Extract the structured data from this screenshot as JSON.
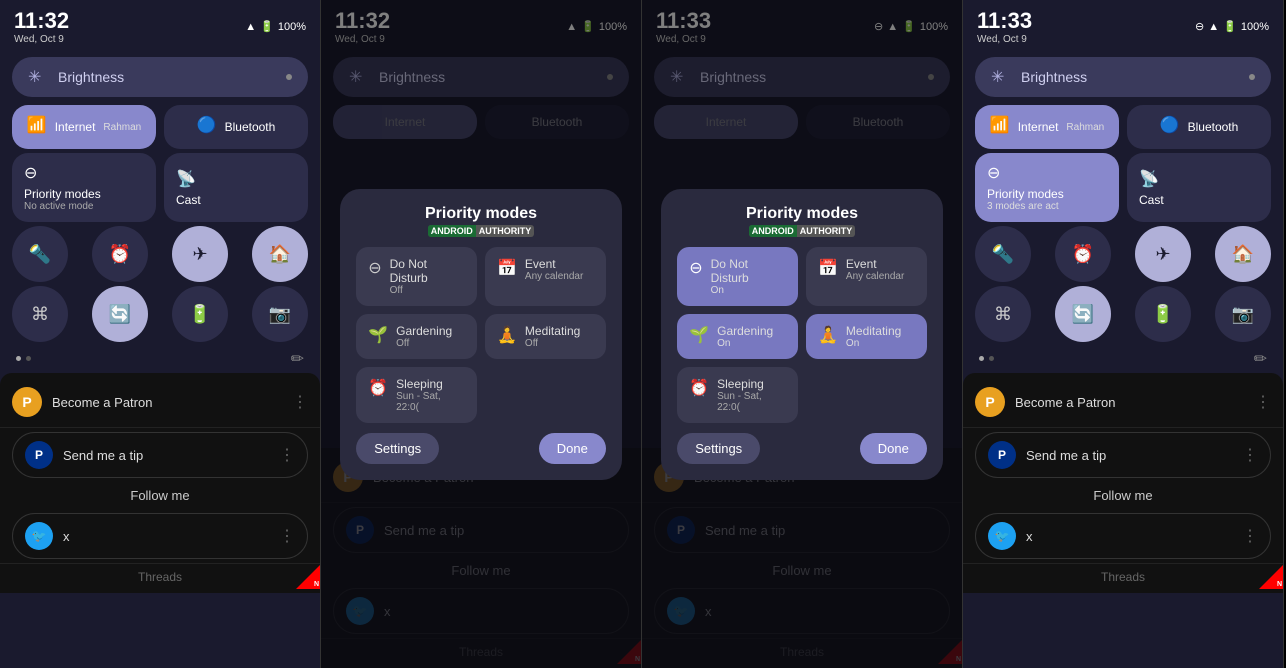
{
  "panels": [
    {
      "id": "panel1",
      "time": "11:32",
      "date": "Wed, Oct 9",
      "battery": "100%",
      "brightness": "Brightness",
      "internet_label": "Internet",
      "internet_sub": "Rahman",
      "bluetooth_label": "Bluetooth",
      "priority_label": "Priority modes",
      "priority_sub": "No active mode",
      "cast_label": "Cast",
      "has_overlay": false,
      "overlay_type": null
    },
    {
      "id": "panel2",
      "time": "11:32",
      "date": "Wed, Oct 9",
      "battery": "100%",
      "brightness": "Brightness",
      "internet_label": "Internet",
      "internet_sub": "Rahman",
      "bluetooth_label": "Bluetooth",
      "has_overlay": true,
      "overlay_type": "modes_off"
    },
    {
      "id": "panel3",
      "time": "11:33",
      "date": "Wed, Oct 9",
      "battery": "100%",
      "brightness": "Brightness",
      "internet_label": "Internet",
      "internet_sub": "Rahman",
      "bluetooth_label": "Bluetooth",
      "has_overlay": true,
      "overlay_type": "modes_on"
    },
    {
      "id": "panel4",
      "time": "11:33",
      "date": "Wed, Oct 9",
      "battery": "100%",
      "brightness": "Brightness",
      "internet_label": "Internet",
      "internet_sub": "Rahman",
      "bluetooth_label": "Bluetooth",
      "priority_label": "Priority modes",
      "priority_sub": "3 modes are act",
      "cast_label": "Cast",
      "has_overlay": false,
      "overlay_type": null
    }
  ],
  "modal": {
    "title": "Priority modes",
    "badge_android": "ANDROID",
    "badge_authority": "AUTHORITY",
    "modes_off": [
      {
        "icon": "⊖",
        "name": "Do Not Disturb",
        "status": "Off"
      },
      {
        "icon": "📅",
        "name": "Event",
        "status": "Any calendar"
      },
      {
        "icon": "🌱",
        "name": "Gardening",
        "status": "Off"
      },
      {
        "icon": "🧘",
        "name": "Meditating",
        "status": "Off"
      },
      {
        "icon": "⏰",
        "name": "Sleeping",
        "status": "Sun - Sat, 22:0("
      }
    ],
    "modes_on": [
      {
        "icon": "⊖",
        "name": "Do Not Disturb",
        "status": "On",
        "active": true
      },
      {
        "icon": "📅",
        "name": "Event",
        "status": "Any calendar"
      },
      {
        "icon": "🌱",
        "name": "Gardening",
        "status": "On",
        "active": true
      },
      {
        "icon": "🧘",
        "name": "Meditating",
        "status": "On",
        "active": true
      },
      {
        "icon": "⏰",
        "name": "Sleeping",
        "status": "Sun - Sat, 22:0("
      }
    ],
    "settings_label": "Settings",
    "done_label": "Done"
  },
  "bottom": {
    "patron_label": "Become a Patron",
    "tip_label": "Send me a tip",
    "follow_label": "Follow me",
    "twitter_label": "x",
    "threads_label": "Threads"
  }
}
